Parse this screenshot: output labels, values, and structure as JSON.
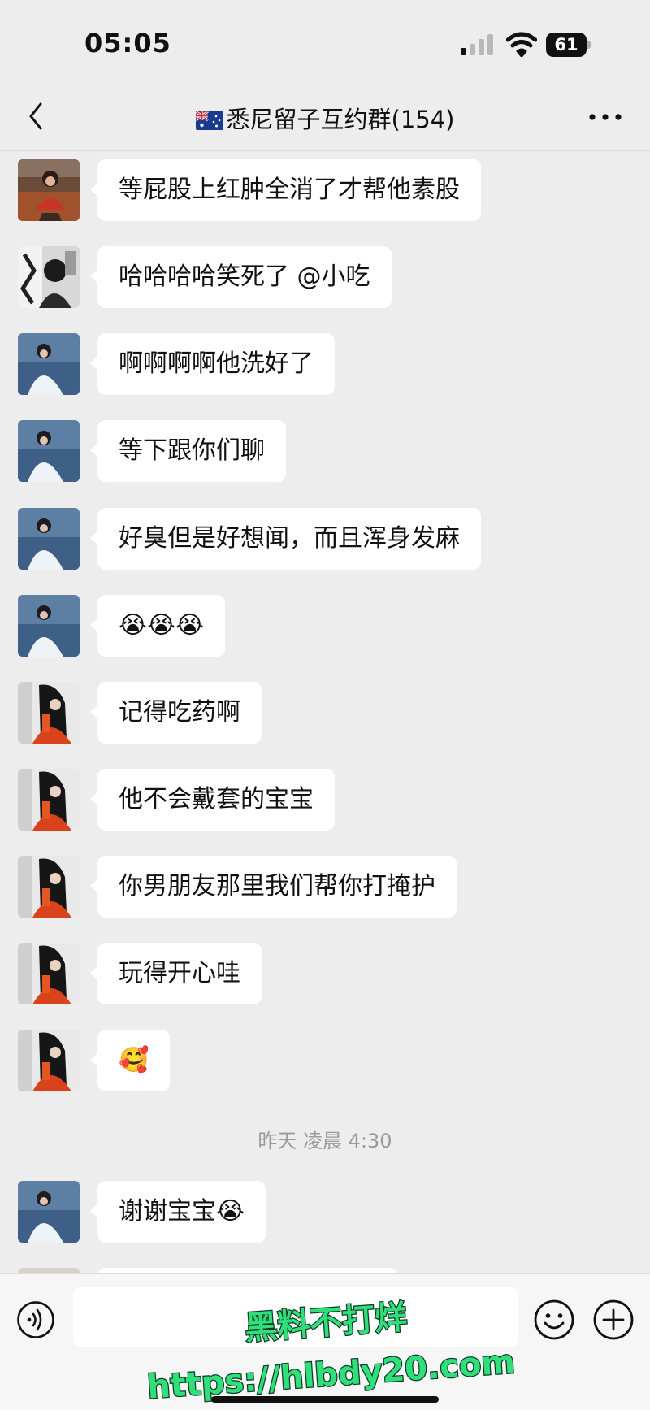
{
  "status_bar": {
    "time": "05:05",
    "battery": "61",
    "signal_bars_active": 1
  },
  "nav": {
    "flag_icon": "australia-flag-icon",
    "title": "悉尼留子互约群(154)",
    "back_icon": "chevron-left-icon",
    "more_icon": "ellipsis-icon"
  },
  "messages": [
    {
      "avatar": "avatar-red-shirt-girl",
      "text": "等屁股上红肿全消了才帮他素股"
    },
    {
      "avatar": "avatar-bw-photo",
      "text": "哈哈哈哈笑死了 @小吃"
    },
    {
      "avatar": "avatar-white-dress",
      "text": "啊啊啊啊他洗好了"
    },
    {
      "avatar": "avatar-white-dress",
      "text": "等下跟你们聊"
    },
    {
      "avatar": "avatar-white-dress",
      "text": "好臭但是好想闻，而且浑身发麻"
    },
    {
      "avatar": "avatar-white-dress",
      "text": "😭😭😭"
    },
    {
      "avatar": "avatar-orange-sweater",
      "text": "记得吃药啊"
    },
    {
      "avatar": "avatar-orange-sweater",
      "text": "他不会戴套的宝宝"
    },
    {
      "avatar": "avatar-orange-sweater",
      "text": "你男朋友那里我们帮你打掩护"
    },
    {
      "avatar": "avatar-orange-sweater",
      "text": "玩得开心哇"
    },
    {
      "avatar": "avatar-orange-sweater",
      "text": "🥰"
    },
    {
      "avatar": "avatar-white-dress",
      "text": "谢谢宝宝😭"
    }
  ],
  "time_divider": "昨天 凌晨 4:30",
  "input_bar": {
    "placeholder": "",
    "voice_icon": "voice-icon",
    "emoji_icon": "smiley-icon",
    "add_icon": "plus-circle-icon"
  },
  "watermark": {
    "line1": "黑料不打烊",
    "line2": "https://hlbdy20.com"
  },
  "colors": {
    "background": "#ededed",
    "bubble": "#ffffff",
    "watermark_fill": "#2fe07a",
    "watermark_stroke": "#0f3a25"
  }
}
